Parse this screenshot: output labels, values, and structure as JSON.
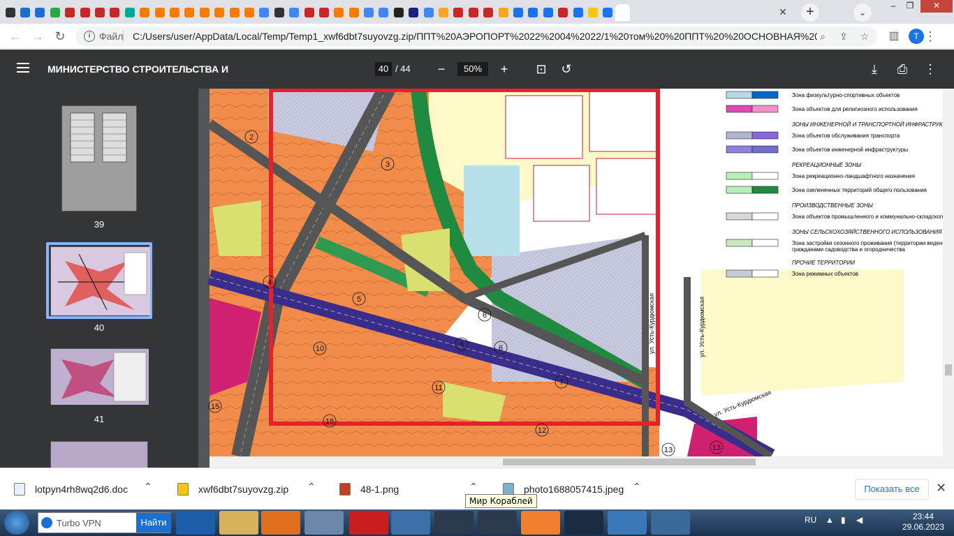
{
  "browser": {
    "tab_favicons": [
      "#333",
      "#1b6fd1",
      "#1b6fd1",
      "#28a745",
      "#c62828",
      "#c62828",
      "#c62828",
      "#c62828",
      "#00a896",
      "#f57c00",
      "#f57c00",
      "#f57c00",
      "#f57c00",
      "#f57c00",
      "#f57c00",
      "#f57c00",
      "#f57c00",
      "#4285f4",
      "#333",
      "#4285f4",
      "#c62828",
      "#c62828",
      "#f57c00",
      "#f57c00",
      "#4285f4",
      "#4285f4",
      "#222",
      "#1a237e",
      "#4285f4",
      "#f5a623",
      "#c62828",
      "#c62828",
      "#c62828",
      "#f5a623",
      "#1a73e8",
      "#1a73e8",
      "#1a73e8",
      "#c62828",
      "#1a73e8",
      "#f5c518",
      "#1a73e8",
      "#ffffff"
    ],
    "tab_close": "✕",
    "new_tab": "+",
    "tab_search": "⌄",
    "win_minimize": "–",
    "win_restore": "❐",
    "win_close": "✕"
  },
  "toolbar": {
    "back": "←",
    "forward": "→",
    "reload": "↻",
    "info": "i",
    "scheme_label": "Файл",
    "url": "C:/Users/user/AppData/Local/Temp/Temp1_xwf6dbt7suyovzg.zip/ППТ%20АЭРОПОРТ%2022%2004%2022/1%20том%20%20ППТ%20%20ОСНОВНАЯ%20...",
    "zoom_icon": "⌕",
    "share_icon": "⇪",
    "star_icon": "☆",
    "sidepanel_icon": "▥",
    "profile_letter": "T",
    "menu_icon": "⋮"
  },
  "pdf": {
    "menu_icon": "☰",
    "title": "МИНИСТЕРСТВО СТРОИТЕЛЬСТВА И",
    "page_current": "40",
    "page_total": "/ 44",
    "zoom_out": "−",
    "zoom_value": "50%",
    "zoom_in": "+",
    "fit_icon": "⊡",
    "rotate_icon": "↺",
    "download_icon": "⤓",
    "print_icon": "⎙",
    "more_icon": "⋮"
  },
  "thumbnails": [
    {
      "page": "39"
    },
    {
      "page": "40"
    },
    {
      "page": "41"
    }
  ],
  "map": {
    "legend": [
      {
        "label": "Зона физкультурно-спортивных объектов",
        "c1": "#b3d9e6",
        "c2": "#0066cc"
      },
      {
        "label": "Зона объектов для религиозного использования",
        "c1": "#e04ab0",
        "c2": "#f090c8"
      },
      {
        "header": "ЗОНЫ ИНЖЕНЕРНОЙ И ТРАНСПОРТНОЙ ИНФРАСТРУКТУ"
      },
      {
        "label": "Зона объектов обслуживания транспорта",
        "c1": "#b0b6d0",
        "c2": "#8866dd"
      },
      {
        "label": "Зона объектов инженерной инфраструктуры",
        "c1": "#9080e0",
        "c2": "#7070cc"
      },
      {
        "header": "РЕКРЕАЦИОННЫЕ ЗОНЫ"
      },
      {
        "label": "Зона рекреационно-ландшафтного назначения",
        "c1": "#b6f0b6",
        "c2": "#ffffff"
      },
      {
        "label": "Зона озелененных территорий общего пользования",
        "c1": "#b6f0b6",
        "c2": "#1f8a40"
      },
      {
        "header": "ПРОИЗВОДСТВЕННЫЕ ЗОНЫ"
      },
      {
        "label": "Зона объектов промышленного и коммунально-складского на",
        "c1": "#d8d8d8",
        "c2": "#ffffff"
      },
      {
        "header": "ЗОНЫ СЕЛЬСКОХОЗЯЙСТВЕННОГО ИСПОЛЬЗОВАНИЯ"
      },
      {
        "label": "Зона застройки сезонного проживания (территории ведения",
        "label2": "гражданами садоводства и огородничества",
        "c1": "#c8e8c0",
        "c2": "#ffffff"
      },
      {
        "header": "ПРОЧИЕ ТЕРРИТОРИИ"
      },
      {
        "label": "Зона режимных объектов",
        "c1": "#c8ccd8",
        "c2": "#ffffff"
      }
    ],
    "street1": "ул. Усть-Курдюмская",
    "street2": "ул. Усть-Курдюмская",
    "street3": "ул. Усть-Курдюмская",
    "zone_numbers": [
      "2",
      "3",
      "4",
      "5",
      "6",
      "6",
      "6",
      "7",
      "10",
      "11",
      "12",
      "13",
      "13",
      "15",
      "16"
    ]
  },
  "downloads": {
    "items": [
      {
        "name": "lotpyn4rh8wq2d6.doc"
      },
      {
        "name": "xwf6dbt7suyovzg.zip"
      },
      {
        "name": "48-1.png"
      },
      {
        "name": "photo1688057415.jpeg"
      }
    ],
    "chevron": "⌃",
    "show_all": "Показать все",
    "close": "✕"
  },
  "tooltip": "Мир Кораблей",
  "taskbar": {
    "vpn_text": "Turbo VPN",
    "vpn_button": "Найти",
    "lang": "RU",
    "time": "23:44",
    "date": "29.06.2023"
  }
}
